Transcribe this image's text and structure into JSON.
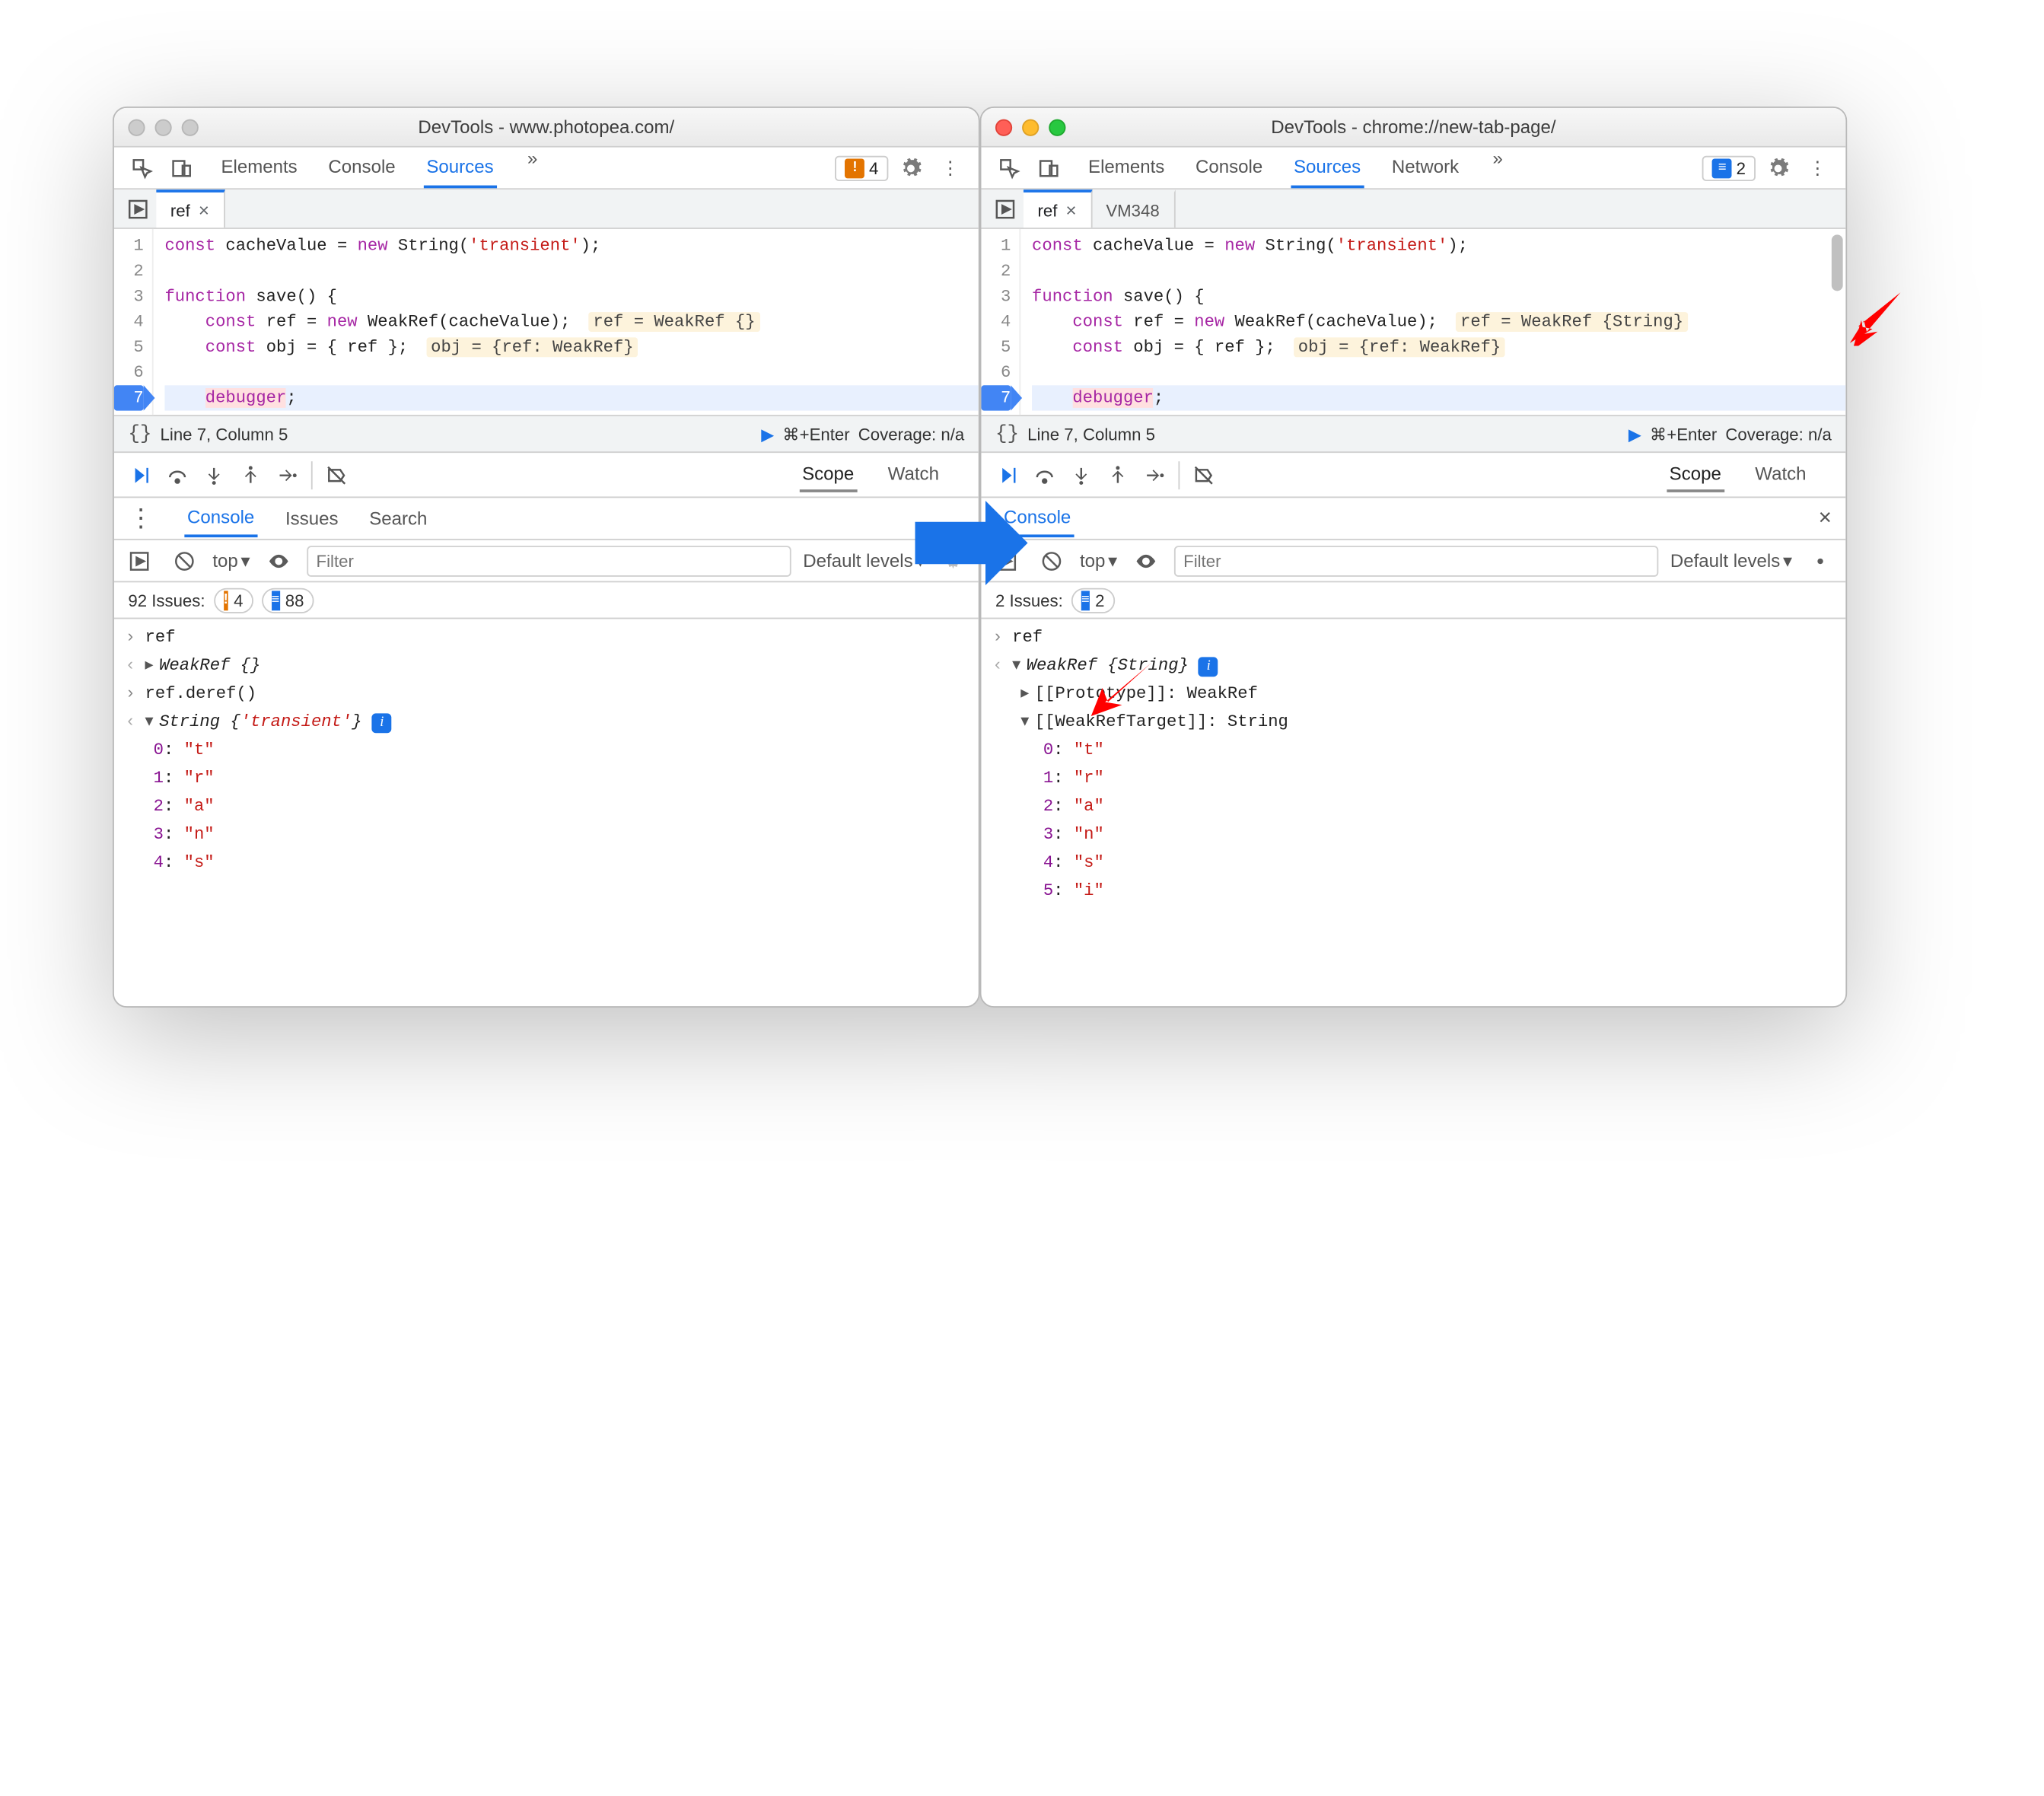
{
  "left": {
    "title": "DevTools - www.photopea.com/",
    "toolbar_tabs": [
      "Elements",
      "Console",
      "Sources"
    ],
    "active_tab": "Sources",
    "issue_badge": {
      "count": "4"
    },
    "file_tabs": [
      {
        "name": "ref",
        "active": true
      }
    ],
    "code": {
      "lines": [
        1,
        2,
        3,
        4,
        5,
        6,
        7
      ],
      "l1": "const cacheValue = new String('transient');",
      "l3": "function save() {",
      "l4": "    const ref = new WeakRef(cacheValue);",
      "l4_hint": "ref = WeakRef {}",
      "l5": "    const obj = { ref };",
      "l5_hint": "obj = {ref: WeakRef}",
      "l7": "    debugger;"
    },
    "status": {
      "lineinfo": "Line 7, Column 5",
      "coverage": "Coverage: n/a",
      "shortcut": "⌘+Enter"
    },
    "scope_tabs": [
      "Scope",
      "Watch"
    ],
    "drawer_tabs": [
      "Console",
      "Issues",
      "Search"
    ],
    "filter": {
      "context": "top",
      "placeholder": "Filter",
      "levels": "Default levels"
    },
    "issues_bar": {
      "text": "92 Issues:",
      "orange": "4",
      "blue": "88"
    },
    "console": {
      "r1": "ref",
      "r2": "WeakRef {}",
      "r3": "ref.deref()",
      "r4": "String {'transient'}",
      "chars": [
        {
          "k": "0",
          "v": "\"t\""
        },
        {
          "k": "1",
          "v": "\"r\""
        },
        {
          "k": "2",
          "v": "\"a\""
        },
        {
          "k": "3",
          "v": "\"n\""
        },
        {
          "k": "4",
          "v": "\"s\""
        }
      ]
    }
  },
  "right": {
    "title": "DevTools - chrome://new-tab-page/",
    "toolbar_tabs": [
      "Elements",
      "Console",
      "Sources",
      "Network"
    ],
    "active_tab": "Sources",
    "issue_badge": {
      "count": "2"
    },
    "file_tabs": [
      {
        "name": "ref",
        "active": true
      },
      {
        "name": "VM348",
        "active": false
      }
    ],
    "code": {
      "l4_hint": "ref = WeakRef {String}",
      "l5_hint": "obj = {ref: WeakRef}"
    },
    "scope_tabs": [
      "Scope",
      "Watch"
    ],
    "drawer_tabs": [
      "Console"
    ],
    "filter": {
      "context": "top",
      "placeholder": "Filter",
      "levels": "Default levels"
    },
    "issues_bar": {
      "text": "2 Issues:",
      "blue": "2"
    },
    "console": {
      "r1": "ref",
      "r2": "WeakRef {String}",
      "proto": "[[Prototype]]: WeakRef",
      "weaktarget": "[[WeakRefTarget]]: String",
      "chars": [
        {
          "k": "0",
          "v": "\"t\""
        },
        {
          "k": "1",
          "v": "\"r\""
        },
        {
          "k": "2",
          "v": "\"a\""
        },
        {
          "k": "3",
          "v": "\"n\""
        },
        {
          "k": "4",
          "v": "\"s\""
        },
        {
          "k": "5",
          "v": "\"i\""
        }
      ]
    }
  }
}
